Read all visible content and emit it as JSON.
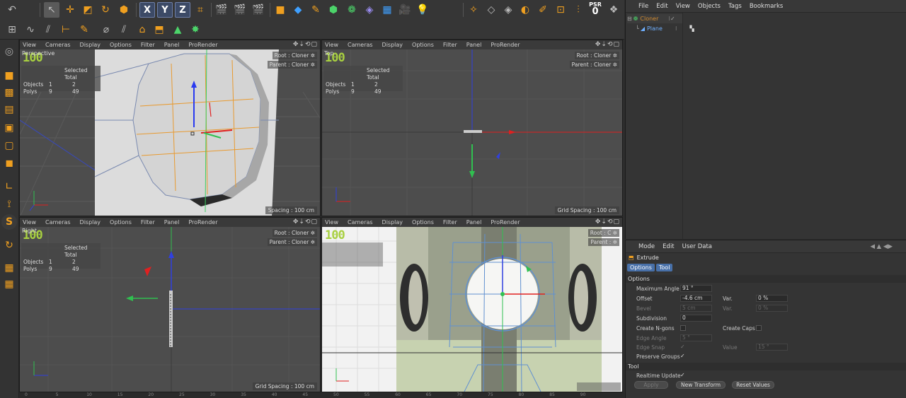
{
  "toolbar": {
    "top_icons": [
      "undo-icon",
      "select-arrow-icon",
      "move-icon",
      "scale-icon",
      "rotate-icon",
      "model-icon",
      "x-axis-icon",
      "y-axis-icon",
      "z-axis-icon",
      "world-coords-icon",
      "render-view-icon",
      "render-pic-icon",
      "render-settings-icon",
      "cube-icon",
      "cube-blue-icon",
      "pen-icon",
      "subdivide-icon",
      "cloner-icon",
      "deformer-icon",
      "floor-icon",
      "camera-icon",
      "light-icon"
    ],
    "axis_x": "X",
    "axis_y": "Y",
    "axis_z": "Z",
    "psr_label": "PSR",
    "psr_value": "0"
  },
  "viewports": [
    {
      "menu": [
        "View",
        "Cameras",
        "Display",
        "Options",
        "Filter",
        "Panel",
        "ProRender"
      ],
      "name": "Perspective",
      "fps": "100",
      "hud": {
        "header": "Selected Total",
        "rows": [
          [
            "Objects",
            "1",
            "2"
          ],
          [
            "Polys",
            "9",
            "49"
          ]
        ]
      },
      "root": "Root : Cloner",
      "parent": "Parent : Cloner",
      "spacing": "Spacing : 100 cm"
    },
    {
      "menu": [
        "View",
        "Cameras",
        "Display",
        "Options",
        "Filter",
        "Panel",
        "ProRender"
      ],
      "name": "Top",
      "fps": "100",
      "hud": {
        "header": "Selected Total",
        "rows": [
          [
            "Objects",
            "1",
            "2"
          ],
          [
            "Polys",
            "9",
            "49"
          ]
        ]
      },
      "root": "Root : Cloner",
      "parent": "Parent : Cloner",
      "spacing": "Grid Spacing : 100 cm"
    },
    {
      "menu": [
        "View",
        "Cameras",
        "Display",
        "Options",
        "Filter",
        "Panel",
        "ProRender"
      ],
      "name": "Right",
      "fps": "100",
      "hud": {
        "header": "Selected Total",
        "rows": [
          [
            "Objects",
            "1",
            "2"
          ],
          [
            "Polys",
            "9",
            "49"
          ]
        ]
      },
      "root": "Root : Cloner",
      "parent": "Parent : Cloner",
      "spacing": "Grid Spacing : 100 cm"
    },
    {
      "menu": [
        "View",
        "Cameras",
        "Display",
        "Options",
        "Filter",
        "Panel",
        "ProRender"
      ],
      "fps": "100",
      "root": "Root : C",
      "parent": "Parent :"
    }
  ],
  "timeline": {
    "ticks": [
      "0",
      "5",
      "10",
      "15",
      "20",
      "25",
      "30",
      "35",
      "40",
      "45",
      "50",
      "55",
      "60",
      "65",
      "70",
      "75",
      "80",
      "85",
      "90"
    ]
  },
  "object_manager": {
    "menu": [
      "File",
      "Edit",
      "View",
      "Objects",
      "Tags",
      "Bookmarks"
    ],
    "objects": [
      {
        "name": "Cloner",
        "color": "#d08a30"
      },
      {
        "name": "Plane",
        "color": "#6fb0ff"
      }
    ]
  },
  "attribute_manager": {
    "menu": [
      "Mode",
      "Edit",
      "User Data"
    ],
    "title": "Extrude",
    "tabs": [
      "Options",
      "Tool"
    ],
    "section_options": "Options",
    "maximum_angle_label": "Maximum Angle",
    "maximum_angle": "91 °",
    "offset_label": "Offset",
    "offset": "-4.6 cm",
    "offset_var_label": "Var.",
    "offset_var": "0 %",
    "bevel_label": "Bevel",
    "bevel": "5 cm",
    "bevel_var_label": "Var.",
    "bevel_var": "0 %",
    "subdivision_label": "Subdivision",
    "subdivision": "0",
    "create_ngons_label": "Create N-gons",
    "create_caps_label": "Create Caps",
    "edge_angle_label": "Edge Angle",
    "edge_angle": "5 °",
    "edge_snap_label": "Edge Snap",
    "value_label": "Value",
    "value": "15 °",
    "preserve_groups_label": "Preserve Groups",
    "section_tool": "Tool",
    "realtime_update_label": "Realtime Update",
    "apply_label": "Apply",
    "new_transform_label": "New Transform",
    "reset_values_label": "Reset Values"
  }
}
